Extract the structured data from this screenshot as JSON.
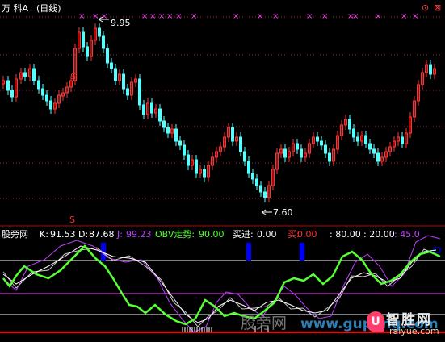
{
  "header": {
    "stock_name": "万 科A",
    "period": "(日线)"
  },
  "window_buttons": {
    "restore": "⊙",
    "close": "⊠"
  },
  "main_chart": {
    "high_label": "9.95",
    "low_label": "7.60",
    "signal_marker": "$",
    "signal_marker_lower": "S",
    "cross_marker": "×"
  },
  "indicator": {
    "name": "股旁网",
    "k_label": "K:",
    "k_value": "91.53",
    "d_label": "D:",
    "d_value": "87.68",
    "j_label": "J:",
    "j_value": "99.23",
    "obv_label": "OBV走势:",
    "obv_value": "90.00",
    "buy_label": "买进:",
    "buy_value": "0.00",
    "sell_label": "买:",
    "sell_value": "0.00",
    "l80": ": 80.00",
    "l20": ": 20.00",
    "l45": ": 45.0"
  },
  "watermarks": {
    "left": "股旁网",
    "url": "www.gupang.com"
  },
  "logo": {
    "title": "智胜网",
    "subtitle": "raiyue.com",
    "badge": "U"
  },
  "colors": {
    "up": "#ff3333",
    "down": "#54ffff",
    "k": "#ffffff",
    "d": "#c8c8c8",
    "j": "#c040ff",
    "obv": "#55ff33",
    "ref_red": "#ff0000",
    "ref_purple": "#ff40ff",
    "buy_bar": "#0000ff",
    "cross": "#ff40ff"
  }
}
